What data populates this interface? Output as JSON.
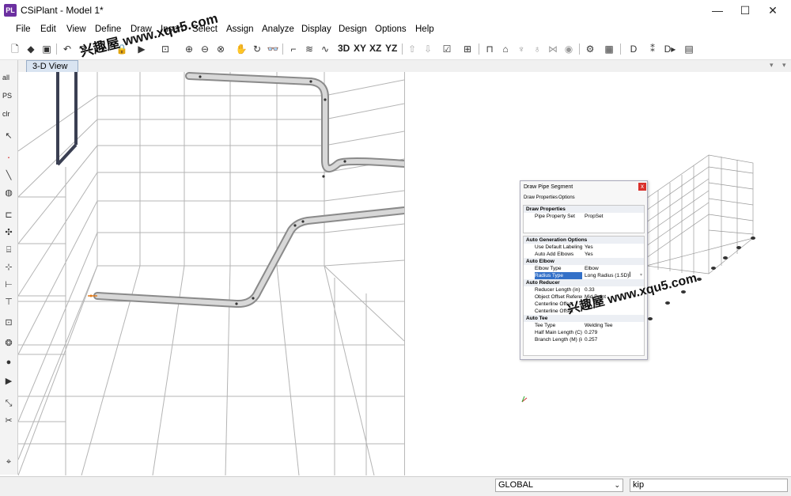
{
  "window": {
    "app_icon_text": "PL",
    "title": "CSiPlant - Model 1*",
    "minimize": "—",
    "maximize": "☐",
    "close": "✕"
  },
  "menu": [
    "File",
    "Edit",
    "View",
    "Define",
    "Draw",
    "Insert",
    "Select",
    "Assign",
    "Analyze",
    "Display",
    "Design",
    "Options",
    "Help"
  ],
  "toolbar": {
    "view_buttons": [
      "3D",
      "XY",
      "XZ",
      "YZ"
    ]
  },
  "left_toolbar": {
    "all_label": "all",
    "ps_label": "PS",
    "clr_label": "clr"
  },
  "tabs": {
    "active": "3-D View"
  },
  "dialog": {
    "title": "Draw Pipe Segment",
    "close": "x",
    "tabs": [
      "Draw Properties",
      "Options"
    ],
    "sections": [
      {
        "title": "Draw Properties",
        "rows": [
          {
            "name": "Pipe Property Set",
            "value": "PropSet"
          }
        ]
      },
      {
        "title": "Auto Generation Options",
        "rows": [
          {
            "name": "Use Default Labeling",
            "value": "Yes"
          },
          {
            "name": "Auto Add Elbows",
            "value": "Yes"
          }
        ]
      },
      {
        "title": "Auto Elbow",
        "rows": [
          {
            "name": "Elbow Type",
            "value": "Elbow"
          },
          {
            "name": "Radius Type",
            "value": "Long Radius (1.5D)"
          }
        ]
      },
      {
        "title": "Auto Reducer",
        "rows": [
          {
            "name": "Reducer Length (in)",
            "value": "0.33"
          },
          {
            "name": "Object Offset Reference",
            "value": "Mid Point"
          },
          {
            "name": "Centerline Offset",
            "value": ""
          },
          {
            "name": "Centerline Offset",
            "value": ""
          }
        ]
      },
      {
        "title": "Auto Tee",
        "rows": [
          {
            "name": "Tee Type",
            "value": "Welding Tee"
          },
          {
            "name": "Half Main Length (C) (in)",
            "value": "0.279"
          },
          {
            "name": "Branch Length (M) (in)",
            "value": "0.257"
          }
        ]
      }
    ]
  },
  "status": {
    "coord_system": "GLOBAL",
    "units": "kip"
  },
  "watermark": {
    "text1": "兴趣屋 www.xqu5.com",
    "text2": "兴趣屋 www.xqu5.com"
  },
  "colors": {
    "app_icon": "#6b2fa0",
    "selection": "#3370c8",
    "pipe": "#a9a9a9",
    "grid": "#b0b0b0",
    "tab_active": "#d9e4f1"
  }
}
